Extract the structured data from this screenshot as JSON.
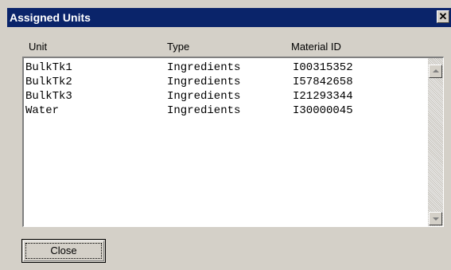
{
  "window": {
    "title": "Assigned Units",
    "close_glyph": "✕"
  },
  "columns": [
    "Unit",
    "Type",
    "Material ID"
  ],
  "rows": [
    {
      "unit": "BulkTk1",
      "type": "Ingredients",
      "material_id": "I00315352"
    },
    {
      "unit": "BulkTk2",
      "type": "Ingredients",
      "material_id": "I57842658"
    },
    {
      "unit": "BulkTk3",
      "type": "Ingredients",
      "material_id": "I21293344"
    },
    {
      "unit": "Water",
      "type": "Ingredients",
      "material_id": "I30000045"
    }
  ],
  "buttons": {
    "close": "Close"
  },
  "colors": {
    "titlebar": "#0a246a",
    "face": "#d4d0c8",
    "list_bg": "#ffffff"
  }
}
